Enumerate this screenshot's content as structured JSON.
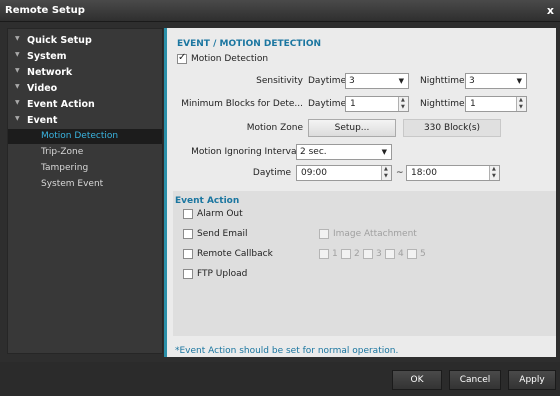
{
  "window": {
    "title": "Remote Setup",
    "close": "x"
  },
  "sidebar": {
    "items": [
      {
        "label": "Quick Setup"
      },
      {
        "label": "System"
      },
      {
        "label": "Network"
      },
      {
        "label": "Video"
      },
      {
        "label": "Event Action"
      },
      {
        "label": "Event"
      }
    ],
    "subitems": [
      {
        "label": "Motion Detection",
        "active": true
      },
      {
        "label": "Trip-Zone"
      },
      {
        "label": "Tampering"
      },
      {
        "label": "System Event"
      }
    ]
  },
  "panel": {
    "heading": "EVENT / MOTION DETECTION",
    "motion_detection": {
      "label": "Motion Detection",
      "checked": true
    },
    "sensitivity": {
      "label": "Sensitivity",
      "daytime_label": "Daytime",
      "daytime_value": "3",
      "nighttime_label": "Nighttime",
      "nighttime_value": "3"
    },
    "min_blocks": {
      "label": "Minimum Blocks for Dete...",
      "daytime_label": "Daytime",
      "daytime_value": "1",
      "nighttime_label": "Nighttime",
      "nighttime_value": "1"
    },
    "motion_zone": {
      "label": "Motion Zone",
      "button": "Setup...",
      "blocks": "330 Block(s)"
    },
    "ignoring_interval": {
      "label": "Motion Ignoring Interval",
      "value": "2 sec."
    },
    "daytime": {
      "label": "Daytime",
      "start": "09:00",
      "separator": "~",
      "end": "18:00"
    },
    "event_action": {
      "heading": "Event Action",
      "alarm_out": "Alarm Out",
      "send_email": "Send Email",
      "image_attachment": "Image Attachment",
      "remote_callback": "Remote Callback",
      "callback_slots": [
        "1",
        "2",
        "3",
        "4",
        "5"
      ],
      "ftp_upload": "FTP Upload"
    },
    "note": "*Event Action should be set for normal operation."
  },
  "footer": {
    "ok": "OK",
    "cancel": "Cancel",
    "apply": "Apply"
  },
  "colors": {
    "accent": "#2a8fa8",
    "heading": "#1b76a0",
    "active_nav": "#3ab4e0"
  }
}
